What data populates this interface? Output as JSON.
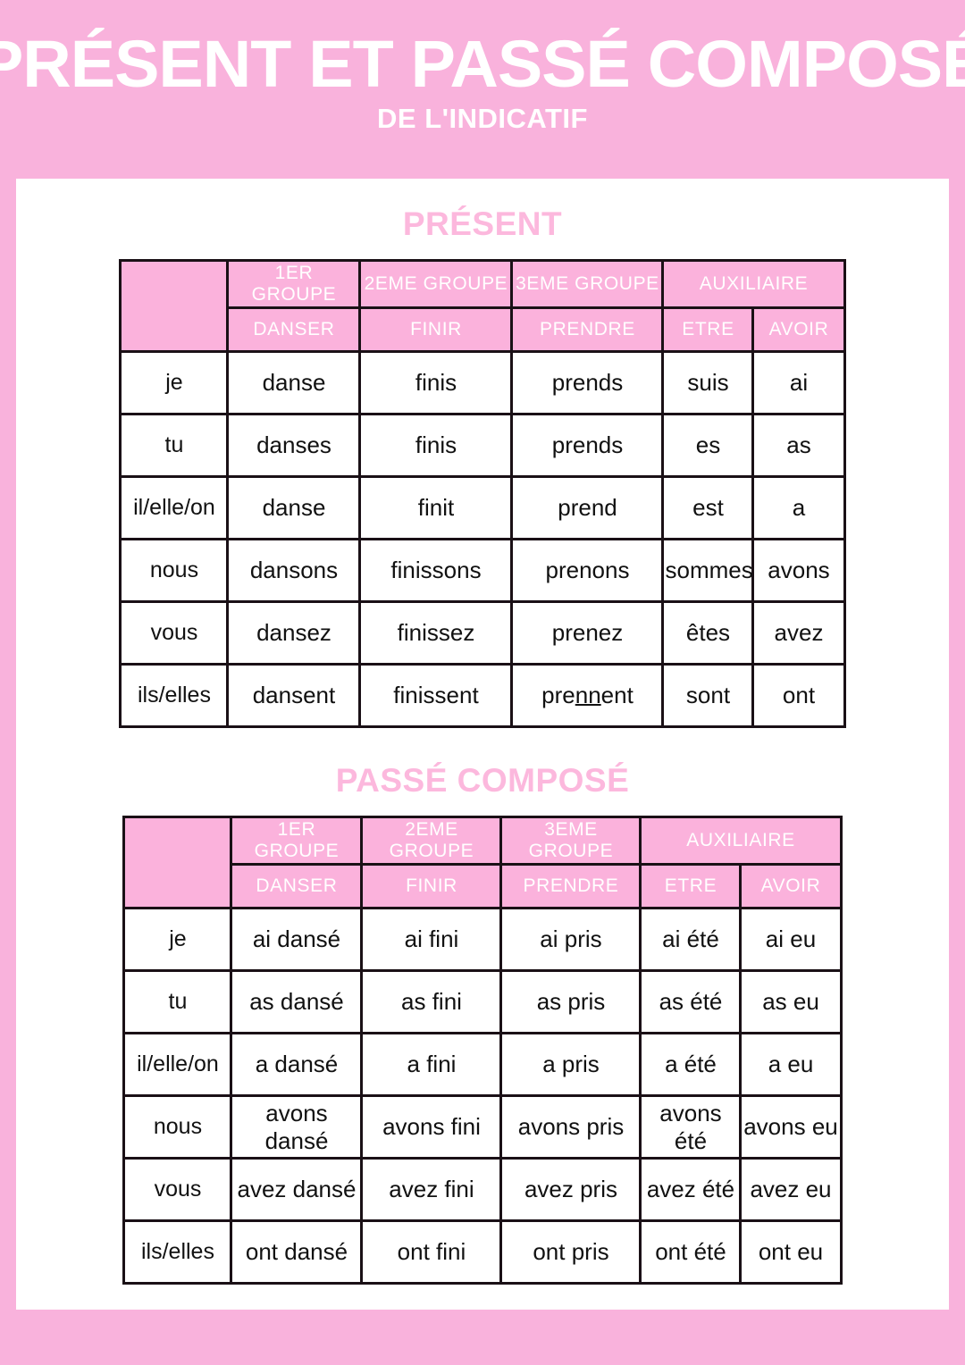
{
  "banner": {
    "title": "PRÉSENT ET PASSÉ COMPOSÉ",
    "subtitle": "DE L'INDICATIF"
  },
  "colors": {
    "banner_pink": "#f9b2dc",
    "header_pink": "#fbb2dc",
    "title_pink": "#fcb8dd",
    "border": "#1a1016",
    "text": "#111111"
  },
  "columns": {
    "groups": [
      "1ER GROUPE",
      "2EME GROUPE",
      "3EME GROUPE"
    ],
    "auxiliary": "AUXILIAIRE",
    "verbs": [
      "DANSER",
      "FINIR",
      "PRENDRE"
    ],
    "auxiliary_verbs": [
      "ETRE",
      "AVOIR"
    ]
  },
  "pronouns": [
    "je",
    "tu",
    "il/elle/on",
    "nous",
    "vous",
    "ils/elles"
  ],
  "sections": [
    {
      "title": "PRÉSENT",
      "rows": [
        {
          "pronoun": "je",
          "danser": "danse",
          "finir": "finis",
          "prendre": "prends",
          "etre": "suis",
          "avoir": "ai"
        },
        {
          "pronoun": "tu",
          "danser": "danses",
          "finir": "finis",
          "prendre": "prends",
          "etre": "es",
          "avoir": "as"
        },
        {
          "pronoun": "il/elle/on",
          "danser": "danse",
          "finir": "finit",
          "prendre": "prend",
          "etre": "est",
          "avoir": "a"
        },
        {
          "pronoun": "nous",
          "danser": "dansons",
          "finir": "finissons",
          "prendre": "prenons",
          "etre": "sommes",
          "avoir": "avons"
        },
        {
          "pronoun": "vous",
          "danser": "dansez",
          "finir": "finissez",
          "prendre": "prenez",
          "etre": "êtes",
          "avoir": "avez"
        },
        {
          "pronoun": "ils/elles",
          "danser": "dansent",
          "finir": "finissent",
          "prendre": "prennent",
          "etre": "sont",
          "avoir": "ont"
        }
      ]
    },
    {
      "title": "PASSÉ COMPOSÉ",
      "rows": [
        {
          "pronoun": "je",
          "danser": "ai dansé",
          "finir": "ai fini",
          "prendre": "ai pris",
          "etre": "ai été",
          "avoir": "ai eu"
        },
        {
          "pronoun": "tu",
          "danser": "as dansé",
          "finir": "as fini",
          "prendre": "as pris",
          "etre": "as été",
          "avoir": "as eu"
        },
        {
          "pronoun": "il/elle/on",
          "danser": "a dansé",
          "finir": "a fini",
          "prendre": "a pris",
          "etre": "a été",
          "avoir": "a eu"
        },
        {
          "pronoun": "nous",
          "danser": "avons dansé",
          "finir": "avons fini",
          "prendre": "avons pris",
          "etre": "avons été",
          "avoir": "avons eu"
        },
        {
          "pronoun": "vous",
          "danser": "avez dansé",
          "finir": "avez fini",
          "prendre": "avez pris",
          "etre": "avez été",
          "avoir": "avez eu"
        },
        {
          "pronoun": "ils/elles",
          "danser": "ont dansé",
          "finir": "ont fini",
          "prendre": "ont pris",
          "etre": "ont été",
          "avoir": "ont eu"
        }
      ]
    }
  ],
  "annotations": {
    "prennent_underline": "nn"
  }
}
